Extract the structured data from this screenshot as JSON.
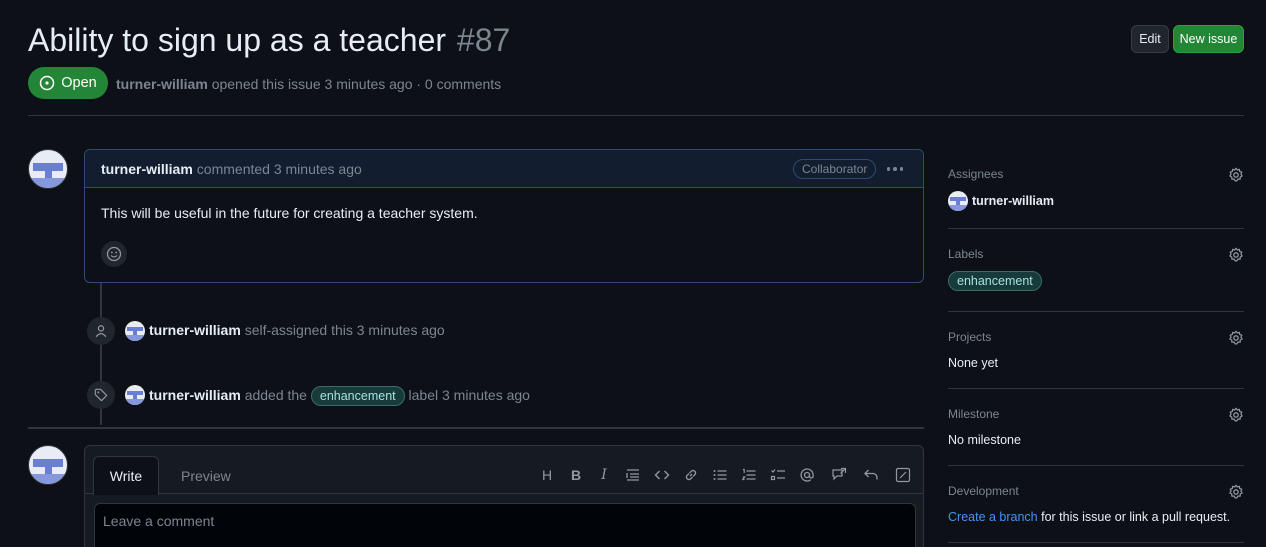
{
  "issue": {
    "title": "Ability to sign up as a teacher",
    "number": "#87",
    "state": "Open",
    "author": "turner-william",
    "meta_text": "opened this issue 3 minutes ago · 0 comments"
  },
  "header_buttons": {
    "edit": "Edit",
    "new_issue": "New issue"
  },
  "comment": {
    "author": "turner-william",
    "action": "commented 3 minutes ago",
    "role_badge": "Collaborator",
    "body": "This will be useful in the future for creating a teacher system."
  },
  "timeline": [
    {
      "actor": "turner-william",
      "text": "self-assigned this 3 minutes ago",
      "icon": "person-icon"
    },
    {
      "actor": "turner-william",
      "text_before": "added the",
      "label": "enhancement",
      "text_after": "label 3 minutes ago",
      "icon": "tag-icon"
    }
  ],
  "editor": {
    "tab_write": "Write",
    "tab_preview": "Preview",
    "placeholder": "Leave a comment",
    "tools": [
      "heading-icon",
      "bold-icon",
      "italic-icon",
      "quote-icon",
      "code-icon",
      "link-icon",
      "unordered-list-icon",
      "ordered-list-icon",
      "task-list-icon",
      "mention-icon",
      "reference-icon",
      "undo-icon",
      "fullscreen-icon"
    ],
    "tool_glyphs": {
      "heading": "H",
      "bold": "B",
      "italic": "I"
    }
  },
  "sidebar": {
    "assignees": {
      "title": "Assignees",
      "value": "turner-william"
    },
    "labels": {
      "title": "Labels",
      "value": "enhancement"
    },
    "projects": {
      "title": "Projects",
      "value": "None yet"
    },
    "milestone": {
      "title": "Milestone",
      "value": "No milestone"
    },
    "development": {
      "title": "Development",
      "link": "Create a branch",
      "text": "for this issue or link a pull request."
    }
  },
  "colors": {
    "background": "#0d1117",
    "open_green": "#238636",
    "link_blue": "#4493f8",
    "label_bg": "#173a3a"
  }
}
